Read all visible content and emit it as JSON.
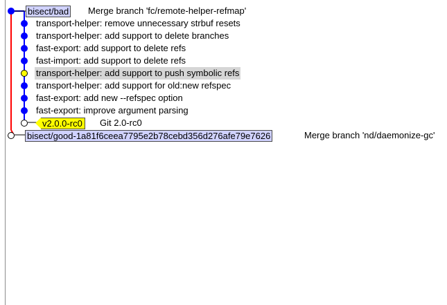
{
  "colors": {
    "mainline": "#0000ff",
    "sideline": "#ff0000",
    "dot_normal": "#0000ff",
    "dot_highlight": "#ffff00",
    "dot_open": "#ffffff",
    "branch_bg": "#d0d2ff",
    "tag_bg": "#ffff00",
    "selection_bg": "#d6d6d6"
  },
  "commits": [
    {
      "message": "Merge branch 'fc/remote-helper-refmap'",
      "ref": "bisect/bad",
      "ref_type": "branch",
      "dot": "normal"
    },
    {
      "message": "transport-helper: remove unnecessary strbuf resets",
      "dot": "normal"
    },
    {
      "message": "transport-helper: add support to delete branches",
      "dot": "normal"
    },
    {
      "message": "fast-export: add support to delete refs",
      "dot": "normal"
    },
    {
      "message": "fast-import: add support to delete refs",
      "dot": "normal"
    },
    {
      "message": "transport-helper: add support to push symbolic refs",
      "dot": "highlight",
      "selected": true
    },
    {
      "message": "transport-helper: add support for old:new refspec",
      "dot": "normal"
    },
    {
      "message": "fast-export: add new --refspec option",
      "dot": "normal"
    },
    {
      "message": "fast-export: improve argument parsing",
      "dot": "normal"
    },
    {
      "message": "Git 2.0-rc0",
      "ref": "v2.0.0-rc0",
      "ref_type": "tag",
      "dot": "open"
    },
    {
      "message": "Merge branch 'nd/daemonize-gc'",
      "ref": "bisect/good-1a81f6ceea7795e2b78cebd356d276afe79e7626",
      "ref_type": "branch",
      "dot": "open"
    }
  ]
}
